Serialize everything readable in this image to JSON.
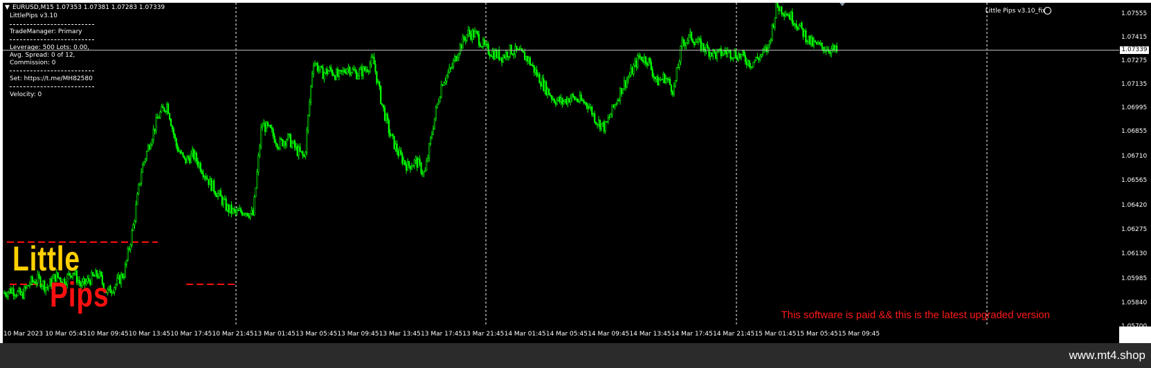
{
  "header": {
    "symbol_info": "EURUSD,M15  1.07353 1.07381 1.07283 1.07339",
    "indicator_title": "LittlePips v3.10"
  },
  "panel": {
    "trade_manager": "TradeManager: Primary",
    "leverage": "Leverage: 500 Lots: 0.00,",
    "spread": "Avg. Spread: 0 of 12,",
    "commission": "Commission: 0",
    "set": "Set: https://t.me/MH82580",
    "velocity": "Velocity: 0"
  },
  "indicator_name": "Little Pips v3.10_fix",
  "logo": {
    "line1": "Little",
    "line2": "Pips"
  },
  "notice": "This software is paid && this is the latest upgraded version",
  "current_price": "1.07339",
  "price_labels": [
    "1.07555",
    "1.07415",
    "1.07275",
    "1.07135",
    "1.06995",
    "1.06855",
    "1.06710",
    "1.06565",
    "1.06420",
    "1.06275",
    "1.06130",
    "1.05985",
    "1.05840",
    "1.05700"
  ],
  "time_labels": [
    "10 Mar 2023",
    "10 Mar 05:45",
    "10 Mar 09:45",
    "10 Mar 13:45",
    "10 Mar 17:45",
    "10 Mar 21:45",
    "13 Mar 01:45",
    "13 Mar 05:45",
    "13 Mar 09:45",
    "13 Mar 13:45",
    "13 Mar 17:45",
    "13 Mar 21:45",
    "14 Mar 01:45",
    "14 Mar 05:45",
    "14 Mar 09:45",
    "14 Mar 13:45",
    "14 Mar 17:45",
    "14 Mar 21:45",
    "15 Mar 01:45",
    "15 Mar 05:45",
    "15 Mar 09:45"
  ],
  "footer": {
    "site": "www.mt4.shop"
  },
  "colors": {
    "candle": "#00ff00",
    "logo_little": "#ffd000",
    "logo_pips": "#ff1010",
    "notice": "#ff1a1a"
  },
  "chart_data": {
    "type": "candlestick",
    "symbol": "EURUSD",
    "timeframe": "M15",
    "ylim": [
      1.057,
      1.0762
    ],
    "closes": [
      1.059,
      1.0592,
      1.0588,
      1.0596,
      1.0598,
      1.0593,
      1.06,
      1.0597,
      1.0603,
      1.0594,
      1.0598,
      1.0601,
      1.059,
      1.0595,
      1.0602,
      1.0628,
      1.0663,
      1.068,
      1.0695,
      1.0702,
      1.0678,
      1.0668,
      1.0672,
      1.0664,
      1.0655,
      1.0648,
      1.064,
      1.0637,
      1.0639,
      1.0636,
      1.069,
      1.0686,
      1.0678,
      1.0682,
      1.0675,
      1.067,
      1.0728,
      1.072,
      1.0722,
      1.0718,
      1.0724,
      1.072,
      1.0722,
      1.0728,
      1.0702,
      1.0683,
      1.0672,
      1.0665,
      1.0668,
      1.066,
      1.069,
      1.0715,
      1.0722,
      1.0735,
      1.0744,
      1.0743,
      1.0735,
      1.0732,
      1.073,
      1.0734,
      1.0732,
      1.0729,
      1.072,
      1.0712,
      1.0705,
      1.0703,
      1.0706,
      1.0704,
      1.0702,
      1.0692,
      1.0688,
      1.07,
      1.0712,
      1.072,
      1.073,
      1.0728,
      1.0715,
      1.0718,
      1.071,
      1.0738,
      1.0742,
      1.0737,
      1.0734,
      1.0731,
      1.0733,
      1.0732,
      1.073,
      1.0726,
      1.073,
      1.0735,
      1.076,
      1.0757,
      1.0752,
      1.0745,
      1.0738,
      1.0736,
      1.0735,
      1.0733
    ]
  }
}
